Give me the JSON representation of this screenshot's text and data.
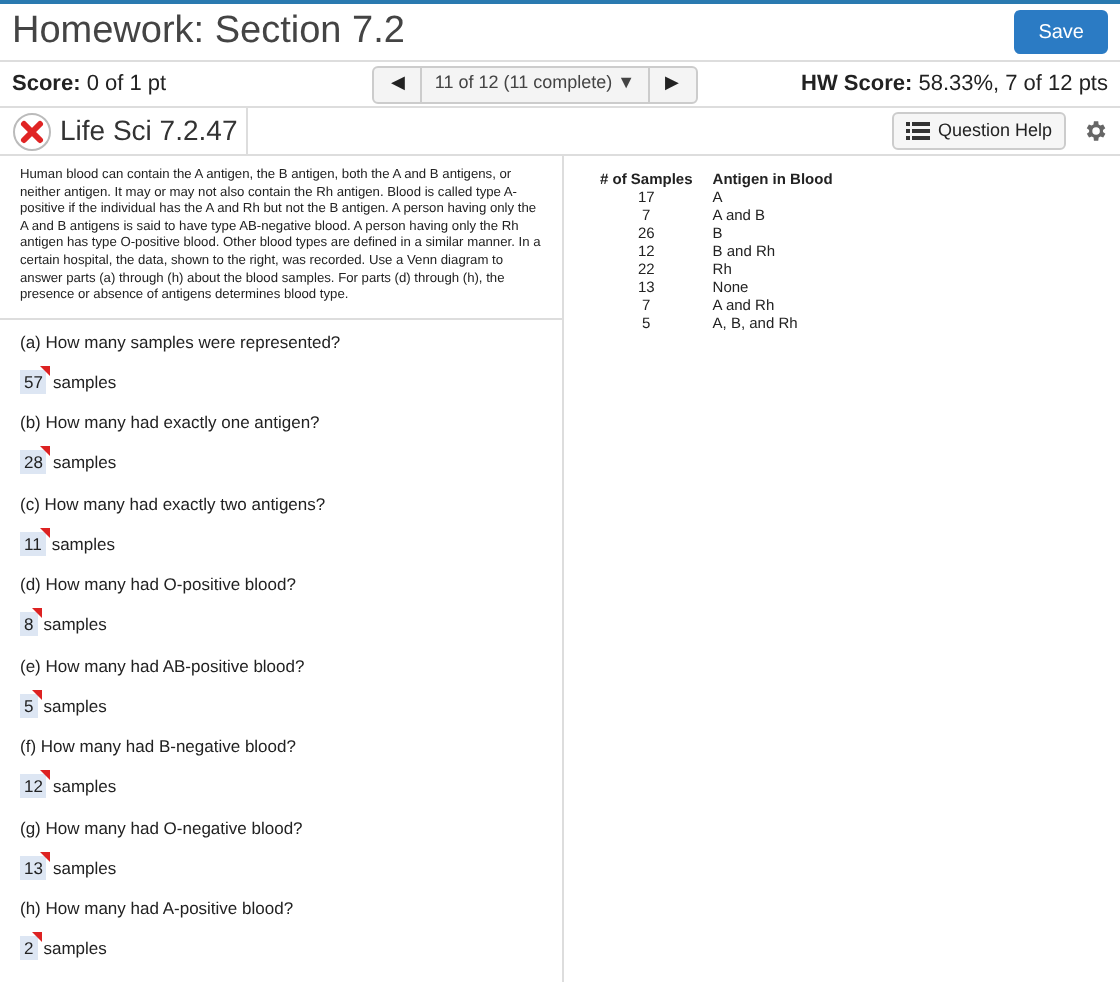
{
  "title": "Homework: Section 7.2",
  "save_button": "Save",
  "score": {
    "label": "Score:",
    "value": "0 of 1 pt"
  },
  "navigator": {
    "prev": "◀",
    "current": "11 of 12 (11 complete)",
    "dropdown": "▼",
    "next": "▶"
  },
  "hw_score": {
    "label": "HW Score:",
    "value": "58.33%, 7 of 12 pts"
  },
  "question": {
    "title": "Life Sci 7.2.47",
    "incorrect": true,
    "help_button": "Question Help"
  },
  "problem_text": "Human blood can contain the A antigen, the B antigen, both the A and B antigens, or neither antigen. It may or may not also contain the Rh antigen. Blood is called type A-positive if the individual has the A and Rh but not the B antigen. A person having only the A and B antigens is said to have type AB-negative blood. A person having only the Rh antigen has type O-positive blood. Other blood types are defined in a similar manner. In a certain hospital, the data, shown to the right, was recorded. Use a Venn diagram to answer parts (a) through (h) about the blood samples.  For parts (d) through (h), the presence or absence of antigens determines blood type.",
  "table": {
    "columns": [
      "# of Samples",
      "Antigen in Blood"
    ],
    "rows": [
      [
        "17",
        "A"
      ],
      [
        "7",
        "A and B"
      ],
      [
        "26",
        "B"
      ],
      [
        "12",
        "B and Rh"
      ],
      [
        "22",
        "Rh"
      ],
      [
        "13",
        "None"
      ],
      [
        "7",
        "A and Rh"
      ],
      [
        "5",
        "A, B, and Rh"
      ]
    ]
  },
  "parts": [
    {
      "prompt": "(a) How many samples were represented?",
      "answer": "57",
      "unit": "samples",
      "flagged": true
    },
    {
      "prompt": "(b) How many had exactly one antigen?",
      "answer": "28",
      "unit": "samples",
      "flagged": true
    },
    {
      "prompt": "(c) How many had exactly two antigens?",
      "answer": "11",
      "unit": "samples",
      "flagged": true
    },
    {
      "prompt": "(d) How many had O-positive blood?",
      "answer": "8",
      "unit": "samples",
      "flagged": true
    },
    {
      "prompt": "(e) How many had AB-positive blood?",
      "answer": "5",
      "unit": "samples",
      "flagged": true
    },
    {
      "prompt": "(f) How many had B-negative blood?",
      "answer": "12",
      "unit": "samples",
      "flagged": true
    },
    {
      "prompt": "(g) How many had O-negative blood?",
      "answer": "13",
      "unit": "samples",
      "flagged": true
    },
    {
      "prompt": "(h) How many had A-positive blood?",
      "answer": "2",
      "unit": "samples",
      "flagged": true
    }
  ]
}
